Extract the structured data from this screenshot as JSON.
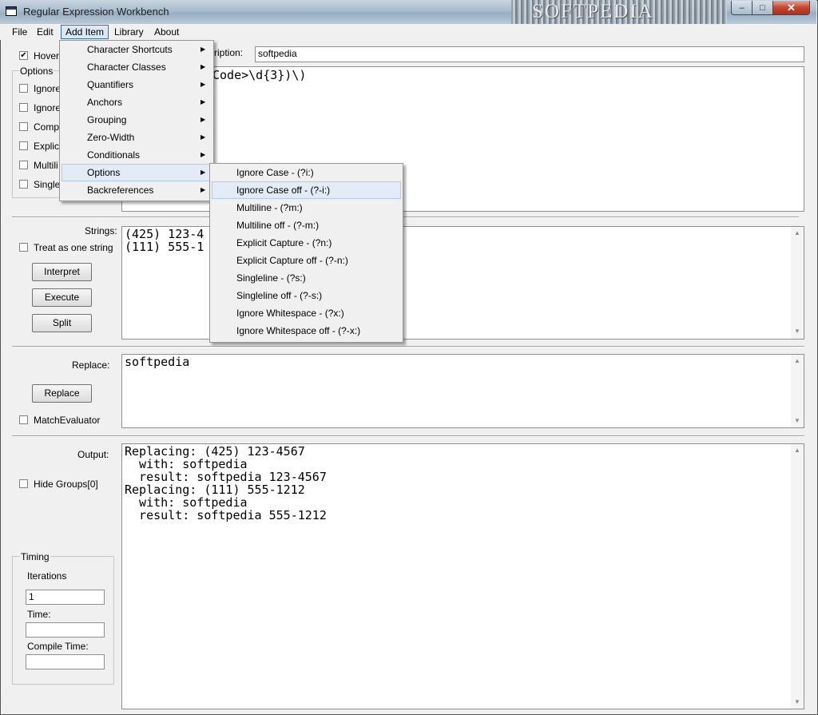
{
  "window": {
    "title": "Regular Expression Workbench",
    "watermark": "SOFTPEDIA",
    "min": "–",
    "max": "□",
    "close": "✕"
  },
  "menubar": [
    "File",
    "Edit",
    "Add Item",
    "Library",
    "About"
  ],
  "left": {
    "hover_label": "Hover",
    "hover_checked": true,
    "options_legend": "Options",
    "option_stubs": [
      "Ignore",
      "Ignore",
      "Compi",
      "Explic",
      "Multili",
      "Single"
    ]
  },
  "description": {
    "label": "ription:",
    "value": "softpedia"
  },
  "regex_text": "Code>\\d{3})\\)",
  "strings": {
    "label": "Strings:",
    "treat_label": "Treat as one string",
    "buttons": [
      "Interpret",
      "Execute",
      "Split"
    ],
    "lines": [
      "(425) 123-4",
      "(111) 555-1"
    ]
  },
  "replace": {
    "label": "Replace:",
    "button": "Replace",
    "evaluator_label": "MatchEvaluator",
    "value": "softpedia"
  },
  "output": {
    "label": "Output:",
    "hide_groups_label": "Hide Groups[0]",
    "lines": [
      "Replacing: (425) 123-4567",
      "  with: softpedia",
      "  result: softpedia 123-4567",
      "Replacing: (111) 555-1212",
      "  with: softpedia",
      "  result: softpedia 555-1212"
    ]
  },
  "timing": {
    "legend": "Timing",
    "iterations_label": "Iterations",
    "iterations_value": "1",
    "time_label": "Time:",
    "compile_label": "Compile Time:"
  },
  "add_item_menu": [
    "Character Shortcuts",
    "Character Classes",
    "Quantifiers",
    "Anchors",
    "Grouping",
    "Zero-Width",
    "Conditionals",
    "Options",
    "Backreferences"
  ],
  "options_submenu": [
    "Ignore Case - (?i:)",
    "Ignore Case off - (?-i:)",
    "Multiline - (?m:)",
    "Multiline off - (?-m:)",
    "Explicit Capture - (?n:)",
    "Explicit Capture off - (?-n:)",
    "Singleline - (?s:)",
    "Singleline off - (?-s:)",
    "Ignore Whitespace - (?x:)",
    "Ignore Whitespace off - (?-x:)"
  ],
  "submenu_arrow": "▶",
  "scroll_up": "▲",
  "scroll_down": "▼",
  "check_mark": "✔",
  "colors": {
    "menu_highlight": "#e2ebf6",
    "title_gradient": "#a8bccd",
    "close_button": "#c3452d"
  }
}
